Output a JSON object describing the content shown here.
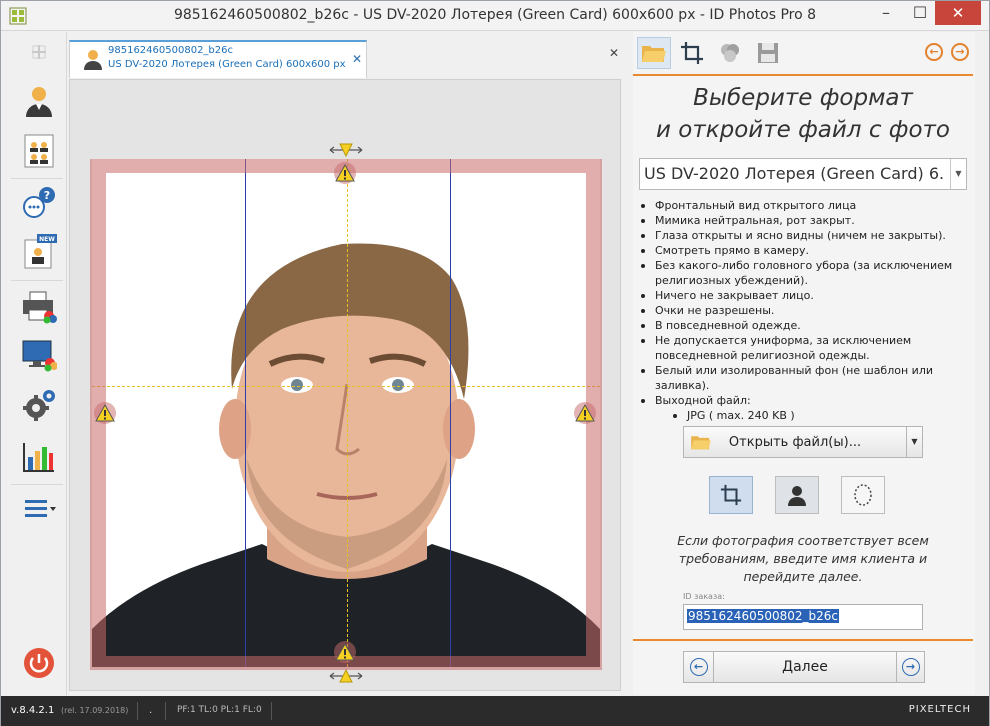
{
  "window": {
    "title": "985162460500802_b26c - US DV-2020 Лотерея (Green Card) 600x600 px - ID Photos Pro 8",
    "minimize_glyph": "–",
    "maximize_glyph": "☐",
    "close_glyph": "✕"
  },
  "left_toolbar": {
    "items": [
      {
        "name": "add-icon"
      },
      {
        "name": "single-person-icon"
      },
      {
        "name": "group-photo-sheet-icon"
      },
      {
        "name": "help-chat-icon"
      },
      {
        "name": "new-template-icon"
      },
      {
        "name": "print-icon"
      },
      {
        "name": "display-icon"
      },
      {
        "name": "settings-icon"
      },
      {
        "name": "statistics-icon"
      },
      {
        "name": "menu-icon"
      },
      {
        "name": "power-icon"
      }
    ]
  },
  "document": {
    "tab_line1": "985162460500802_b26c",
    "tab_line2": "US DV-2020 Лотерея (Green Card) 600x600 px",
    "tab_close": "✕",
    "close_all": "✕"
  },
  "right_panel": {
    "heading_line1": "Выберите формат",
    "heading_line2": "и откройте файл с фото",
    "format_selected": "US DV-2020 Лотерея (Green Card) 6...",
    "requirements": [
      "Фронтальный вид открытого лица",
      "Мимика нейтральная, рот закрыт.",
      "Глаза открыты и ясно видны (ничем не закрыты).",
      "Смотреть прямо в камеру.",
      "Без какого-либо головного убора (за исключением религиозных убеждений).",
      "Ничего не закрывает лицо.",
      "Очки не разрешены.",
      "В повседневной одежде.",
      "Не допускается униформа, за исключением повседневной религиозной одежды.",
      "Белый или изолированный фон (не шаблон или заливка).",
      "Выходной файл:"
    ],
    "output_format": "JPG  ( max. 240 KB )",
    "open_button": "Открыть файл(ы)...",
    "info_text": "Если фотография соответствует всем требованиям, введите имя клиента и перейдите далее.",
    "order_label": "ID заказа:",
    "order_value": "985162460500802_b26c",
    "next_button": "Далее"
  },
  "statusbar": {
    "version": "v.8.4.2.1",
    "release": "(rel. 17.09.2018)",
    "dot": ".",
    "metrics": "PF:1 TL:0 PL:1 FL:0",
    "brand": "PIXELTECH"
  },
  "colors": {
    "accent_orange": "#e8892f",
    "accent_blue": "#2e6bb3",
    "warning_yellow": "#f5d022",
    "crop_red": "#c86969"
  }
}
